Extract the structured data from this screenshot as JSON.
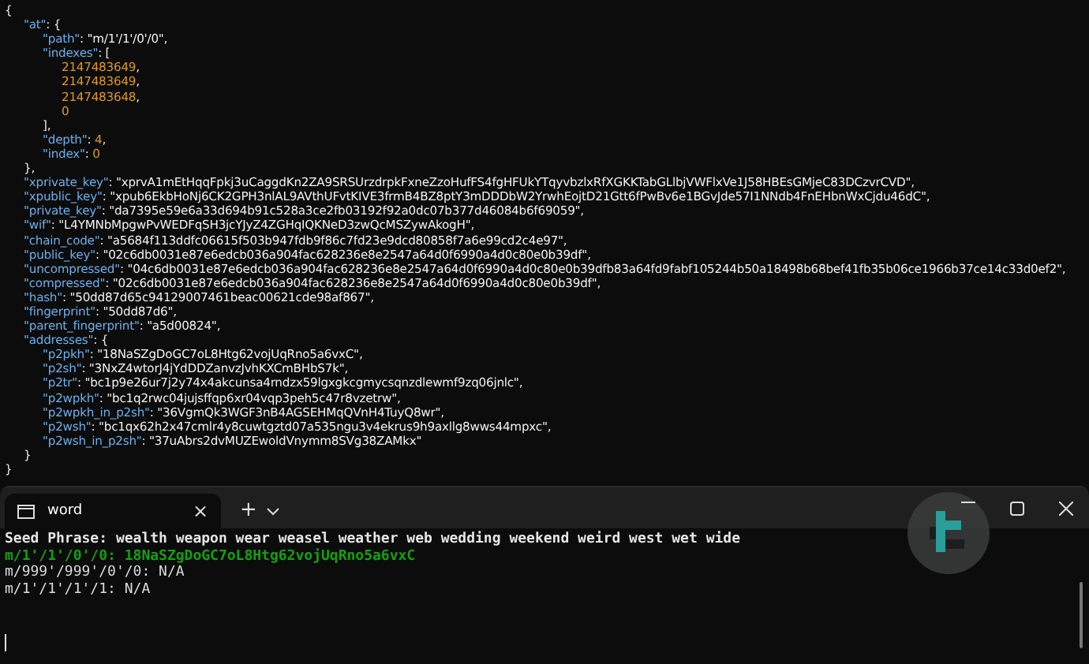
{
  "document": {
    "lines": [
      {
        "tokens": [
          {
            "kind": "punct",
            "text": "{"
          }
        ],
        "children": [
          {
            "tokens": [
              {
                "kind": "key",
                "text": "\"at\""
              },
              {
                "kind": "punct",
                "text": ": {"
              }
            ],
            "children": [
              {
                "tokens": [
                  {
                    "kind": "key",
                    "text": "\"path\""
                  },
                  {
                    "kind": "punct",
                    "text": ": "
                  },
                  {
                    "kind": "string",
                    "text": "\"m/1'/1'/0'/0\""
                  },
                  {
                    "kind": "punct",
                    "text": ","
                  }
                ]
              },
              {
                "tokens": [
                  {
                    "kind": "key",
                    "text": "\"indexes\""
                  },
                  {
                    "kind": "punct",
                    "text": ": ["
                  }
                ],
                "children": [
                  {
                    "tokens": [
                      {
                        "kind": "number",
                        "text": "2147483649"
                      },
                      {
                        "kind": "punct",
                        "text": ","
                      }
                    ]
                  },
                  {
                    "tokens": [
                      {
                        "kind": "number",
                        "text": "2147483649"
                      },
                      {
                        "kind": "punct",
                        "text": ","
                      }
                    ]
                  },
                  {
                    "tokens": [
                      {
                        "kind": "number",
                        "text": "2147483648"
                      },
                      {
                        "kind": "punct",
                        "text": ","
                      }
                    ]
                  },
                  {
                    "tokens": [
                      {
                        "kind": "number",
                        "text": "0"
                      }
                    ]
                  }
                ]
              },
              {
                "tokens": [
                  {
                    "kind": "punct",
                    "text": "],"
                  }
                ]
              },
              {
                "tokens": [
                  {
                    "kind": "key",
                    "text": "\"depth\""
                  },
                  {
                    "kind": "punct",
                    "text": ": "
                  },
                  {
                    "kind": "number",
                    "text": "4"
                  },
                  {
                    "kind": "punct",
                    "text": ","
                  }
                ]
              },
              {
                "tokens": [
                  {
                    "kind": "key",
                    "text": "\"index\""
                  },
                  {
                    "kind": "punct",
                    "text": ": "
                  },
                  {
                    "kind": "number",
                    "text": "0"
                  }
                ]
              }
            ]
          },
          {
            "tokens": [
              {
                "kind": "punct",
                "text": "},"
              }
            ]
          },
          {
            "tokens": [
              {
                "kind": "key",
                "text": "\"xprivate_key\""
              },
              {
                "kind": "punct",
                "text": ": "
              },
              {
                "kind": "string",
                "text": "\"xprvA1mEtHqqFpkj3uCaggdKn2ZA9SRSUrzdrpkFxneZzoHufFS4fgHFUkYTqyvbzlxRfXGKKTabGLlbjVWFlxVe1J58HBEsGMjeC83DCzvrCVD\""
              },
              {
                "kind": "punct",
                "text": ","
              }
            ]
          },
          {
            "tokens": [
              {
                "kind": "key",
                "text": "\"xpublic_key\""
              },
              {
                "kind": "punct",
                "text": ": "
              },
              {
                "kind": "string",
                "text": "\"xpub6EkbHoNj6CK2GPH3nlAL9AVthUFvtKIVE3frmB4BZ8ptY3mDDDbW2YrwhEojtD21Gtt6fPwBv6e1BGvJde57I1NNdb4FnEHbnWxCjdu46dC\""
              },
              {
                "kind": "punct",
                "text": ","
              }
            ]
          },
          {
            "tokens": [
              {
                "kind": "key",
                "text": "\"private_key\""
              },
              {
                "kind": "punct",
                "text": ": "
              },
              {
                "kind": "string",
                "text": "\"da7395e59e6a33d694b91c528a3ce2fb03192f92a0dc07b377d46084b6f69059\""
              },
              {
                "kind": "punct",
                "text": ","
              }
            ]
          },
          {
            "tokens": [
              {
                "kind": "key",
                "text": "\"wif\""
              },
              {
                "kind": "punct",
                "text": ": "
              },
              {
                "kind": "string",
                "text": "\"L4YMNbMpgwPvWEDFqSH3jcYJyZ4ZGHqIQKNeD3zwQcMSZywAkogH\""
              },
              {
                "kind": "punct",
                "text": ","
              }
            ]
          },
          {
            "tokens": [
              {
                "kind": "key",
                "text": "\"chain_code\""
              },
              {
                "kind": "punct",
                "text": ": "
              },
              {
                "kind": "string",
                "text": "\"a5684f113ddfc06615f503b947fdb9f86c7fd23e9dcd80858f7a6e99cd2c4e97\""
              },
              {
                "kind": "punct",
                "text": ","
              }
            ]
          },
          {
            "tokens": [
              {
                "kind": "key",
                "text": "\"public_key\""
              },
              {
                "kind": "punct",
                "text": ": "
              },
              {
                "kind": "string",
                "text": "\"02c6db0031e87e6edcb036a904fac628236e8e2547a64d0f6990a4d0c80e0b39df\""
              },
              {
                "kind": "punct",
                "text": ","
              }
            ]
          },
          {
            "tokens": [
              {
                "kind": "key",
                "text": "\"uncompressed\""
              },
              {
                "kind": "punct",
                "text": ": "
              },
              {
                "kind": "string",
                "text": "\"04c6db0031e87e6edcb036a904fac628236e8e2547a64d0f6990a4d0c80e0b39dfb83a64fd9fabf105244b50a18498b68bef41fb35b06ce1966b37ce14c33d0ef2\""
              },
              {
                "kind": "punct",
                "text": ","
              }
            ]
          },
          {
            "tokens": [
              {
                "kind": "key",
                "text": "\"compressed\""
              },
              {
                "kind": "punct",
                "text": ": "
              },
              {
                "kind": "string",
                "text": "\"02c6db0031e87e6edcb036a904fac628236e8e2547a64d0f6990a4d0c80e0b39df\""
              },
              {
                "kind": "punct",
                "text": ","
              }
            ]
          },
          {
            "tokens": [
              {
                "kind": "key",
                "text": "\"hash\""
              },
              {
                "kind": "punct",
                "text": ": "
              },
              {
                "kind": "string",
                "text": "\"50dd87d65c94129007461beac00621cde98af867\""
              },
              {
                "kind": "punct",
                "text": ","
              }
            ]
          },
          {
            "tokens": [
              {
                "kind": "key",
                "text": "\"fingerprint\""
              },
              {
                "kind": "punct",
                "text": ": "
              },
              {
                "kind": "string",
                "text": "\"50dd87d6\""
              },
              {
                "kind": "punct",
                "text": ","
              }
            ]
          },
          {
            "tokens": [
              {
                "kind": "key",
                "text": "\"parent_fingerprint\""
              },
              {
                "kind": "punct",
                "text": ": "
              },
              {
                "kind": "string",
                "text": "\"a5d00824\""
              },
              {
                "kind": "punct",
                "text": ","
              }
            ]
          },
          {
            "tokens": [
              {
                "kind": "key",
                "text": "\"addresses\""
              },
              {
                "kind": "punct",
                "text": ": {"
              }
            ],
            "children": [
              {
                "tokens": [
                  {
                    "kind": "key",
                    "text": "\"p2pkh\""
                  },
                  {
                    "kind": "punct",
                    "text": ": "
                  },
                  {
                    "kind": "string",
                    "text": "\"18NaSZgDoGC7oL8Htg62vojUqRno5a6vxC\""
                  },
                  {
                    "kind": "punct",
                    "text": ","
                  }
                ]
              },
              {
                "tokens": [
                  {
                    "kind": "key",
                    "text": "\"p2sh\""
                  },
                  {
                    "kind": "punct",
                    "text": ": "
                  },
                  {
                    "kind": "string",
                    "text": "\"3NxZ4wtorJ4jYdDDZanvzJvhKXCmBHbS7k\""
                  },
                  {
                    "kind": "punct",
                    "text": ","
                  }
                ]
              },
              {
                "tokens": [
                  {
                    "kind": "key",
                    "text": "\"p2tr\""
                  },
                  {
                    "kind": "punct",
                    "text": ": "
                  },
                  {
                    "kind": "string",
                    "text": "\"bc1p9e26ur7j2y74x4akcunsa4rndzx59lgxgkcgmycsqnzdlewmf9zq06jnlc\""
                  },
                  {
                    "kind": "punct",
                    "text": ","
                  }
                ]
              },
              {
                "tokens": [
                  {
                    "kind": "key",
                    "text": "\"p2wpkh\""
                  },
                  {
                    "kind": "punct",
                    "text": ": "
                  },
                  {
                    "kind": "string",
                    "text": "\"bc1q2rwc04jujsffqp6xr04vqp3peh5c47r8vzetrw\""
                  },
                  {
                    "kind": "punct",
                    "text": ","
                  }
                ]
              },
              {
                "tokens": [
                  {
                    "kind": "key",
                    "text": "\"p2wpkh_in_p2sh\""
                  },
                  {
                    "kind": "punct",
                    "text": ": "
                  },
                  {
                    "kind": "string",
                    "text": "\"36VgmQk3WGF3nB4AGSEHMqQVnH4TuyQ8wr\""
                  },
                  {
                    "kind": "punct",
                    "text": ","
                  }
                ]
              },
              {
                "tokens": [
                  {
                    "kind": "key",
                    "text": "\"p2wsh\""
                  },
                  {
                    "kind": "punct",
                    "text": ": "
                  },
                  {
                    "kind": "string",
                    "text": "\"bc1qx62h2x47cmlr4y8cuwtgztd07a535ngu3v4ekrus9h9axllg8wws44mpxc\""
                  },
                  {
                    "kind": "punct",
                    "text": ","
                  }
                ]
              },
              {
                "tokens": [
                  {
                    "kind": "key",
                    "text": "\"p2wsh_in_p2sh\""
                  },
                  {
                    "kind": "punct",
                    "text": ": "
                  },
                  {
                    "kind": "string",
                    "text": "\"37uAbrs2dvMUZEwoldVnymm8SVg38ZAMkx\""
                  }
                ]
              }
            ]
          },
          {
            "tokens": [
              {
                "kind": "punct",
                "text": "}"
              }
            ]
          }
        ]
      },
      {
        "tokens": [
          {
            "kind": "punct",
            "text": "}"
          }
        ]
      }
    ]
  },
  "terminal": {
    "tabs": [
      {
        "title": "word",
        "close": "×",
        "selected": true
      }
    ],
    "new_tab": "+",
    "output": [
      {
        "kind": "heading",
        "text": "Seed Phrase: wealth weapon wear weasel weather web wedding weekend weird west wet wide"
      },
      {
        "kind": "match",
        "text": "m/1'/1'/0'/0: 18NaSZgDoGC7oL8Htg62vojUqRno5a6vxC"
      },
      {
        "kind": "plain",
        "text": "m/999'/999'/0'/0: N/A"
      },
      {
        "kind": "plain",
        "text": "m/1'/1'/1'/1: N/A"
      }
    ]
  }
}
